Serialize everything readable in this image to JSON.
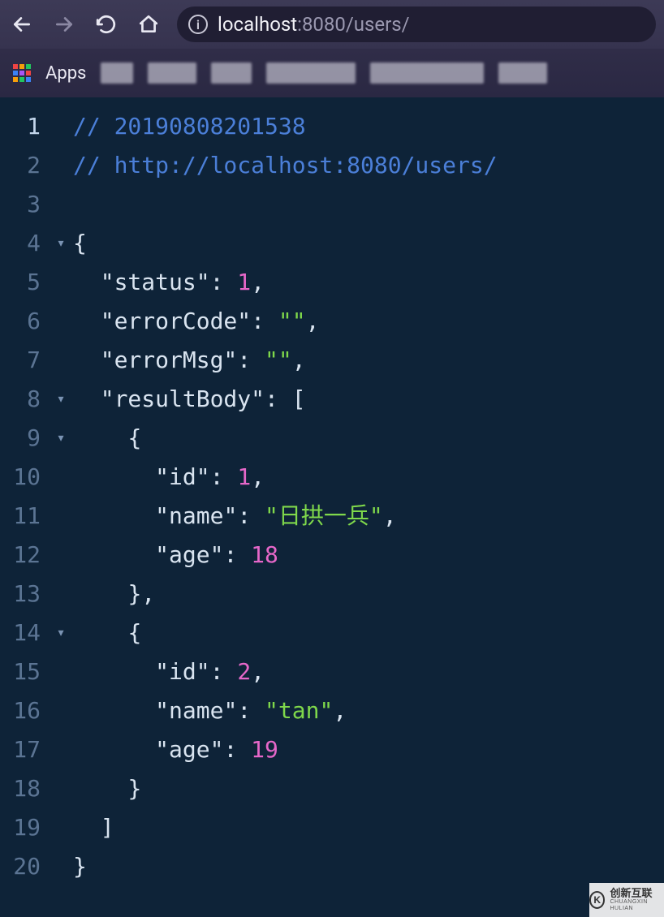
{
  "toolbar": {
    "url_host": "localhost",
    "url_port_path": ":8080/users/"
  },
  "bookmarks": {
    "apps_label": "Apps"
  },
  "code": {
    "lines": [
      {
        "n": 1,
        "fold": "",
        "indent": 0,
        "type": "comment",
        "text": "// 20190808201538"
      },
      {
        "n": 2,
        "fold": "",
        "indent": 0,
        "type": "comment",
        "text": "// http://localhost:8080/users/"
      },
      {
        "n": 3,
        "fold": "",
        "indent": 0,
        "type": "blank",
        "text": ""
      },
      {
        "n": 4,
        "fold": "▾",
        "indent": 0,
        "type": "punc",
        "text": "{"
      },
      {
        "n": 5,
        "fold": "",
        "indent": 1,
        "type": "kv",
        "key": "\"status\"",
        "colon": ": ",
        "val": "1",
        "valClass": "c-num",
        "trail": ","
      },
      {
        "n": 6,
        "fold": "",
        "indent": 1,
        "type": "kv",
        "key": "\"errorCode\"",
        "colon": ": ",
        "val": "\"\"",
        "valClass": "c-str",
        "trail": ","
      },
      {
        "n": 7,
        "fold": "",
        "indent": 1,
        "type": "kv",
        "key": "\"errorMsg\"",
        "colon": ": ",
        "val": "\"\"",
        "valClass": "c-str",
        "trail": ","
      },
      {
        "n": 8,
        "fold": "▾",
        "indent": 1,
        "type": "kv",
        "key": "\"resultBody\"",
        "colon": ": ",
        "val": "[",
        "valClass": "c-punc",
        "trail": ""
      },
      {
        "n": 9,
        "fold": "▾",
        "indent": 2,
        "type": "punc",
        "text": "{"
      },
      {
        "n": 10,
        "fold": "",
        "indent": 3,
        "type": "kv",
        "key": "\"id\"",
        "colon": ": ",
        "val": "1",
        "valClass": "c-num",
        "trail": ","
      },
      {
        "n": 11,
        "fold": "",
        "indent": 3,
        "type": "kv",
        "key": "\"name\"",
        "colon": ": ",
        "val": "\"日拱一兵\"",
        "valClass": "c-str",
        "trail": ","
      },
      {
        "n": 12,
        "fold": "",
        "indent": 3,
        "type": "kv",
        "key": "\"age\"",
        "colon": ": ",
        "val": "18",
        "valClass": "c-num",
        "trail": ""
      },
      {
        "n": 13,
        "fold": "",
        "indent": 2,
        "type": "punc",
        "text": "},"
      },
      {
        "n": 14,
        "fold": "▾",
        "indent": 2,
        "type": "punc",
        "text": "{"
      },
      {
        "n": 15,
        "fold": "",
        "indent": 3,
        "type": "kv",
        "key": "\"id\"",
        "colon": ": ",
        "val": "2",
        "valClass": "c-num",
        "trail": ","
      },
      {
        "n": 16,
        "fold": "",
        "indent": 3,
        "type": "kv",
        "key": "\"name\"",
        "colon": ": ",
        "val": "\"tan\"",
        "valClass": "c-str",
        "trail": ","
      },
      {
        "n": 17,
        "fold": "",
        "indent": 3,
        "type": "kv",
        "key": "\"age\"",
        "colon": ": ",
        "val": "19",
        "valClass": "c-num",
        "trail": ""
      },
      {
        "n": 18,
        "fold": "",
        "indent": 2,
        "type": "punc",
        "text": "}"
      },
      {
        "n": 19,
        "fold": "",
        "indent": 1,
        "type": "punc",
        "text": "]"
      },
      {
        "n": 20,
        "fold": "",
        "indent": 0,
        "type": "punc",
        "text": "}"
      }
    ],
    "indent_unit": "  "
  },
  "watermark": {
    "cn": "创新互联",
    "en": "CHUANGXIN HULIAN"
  }
}
